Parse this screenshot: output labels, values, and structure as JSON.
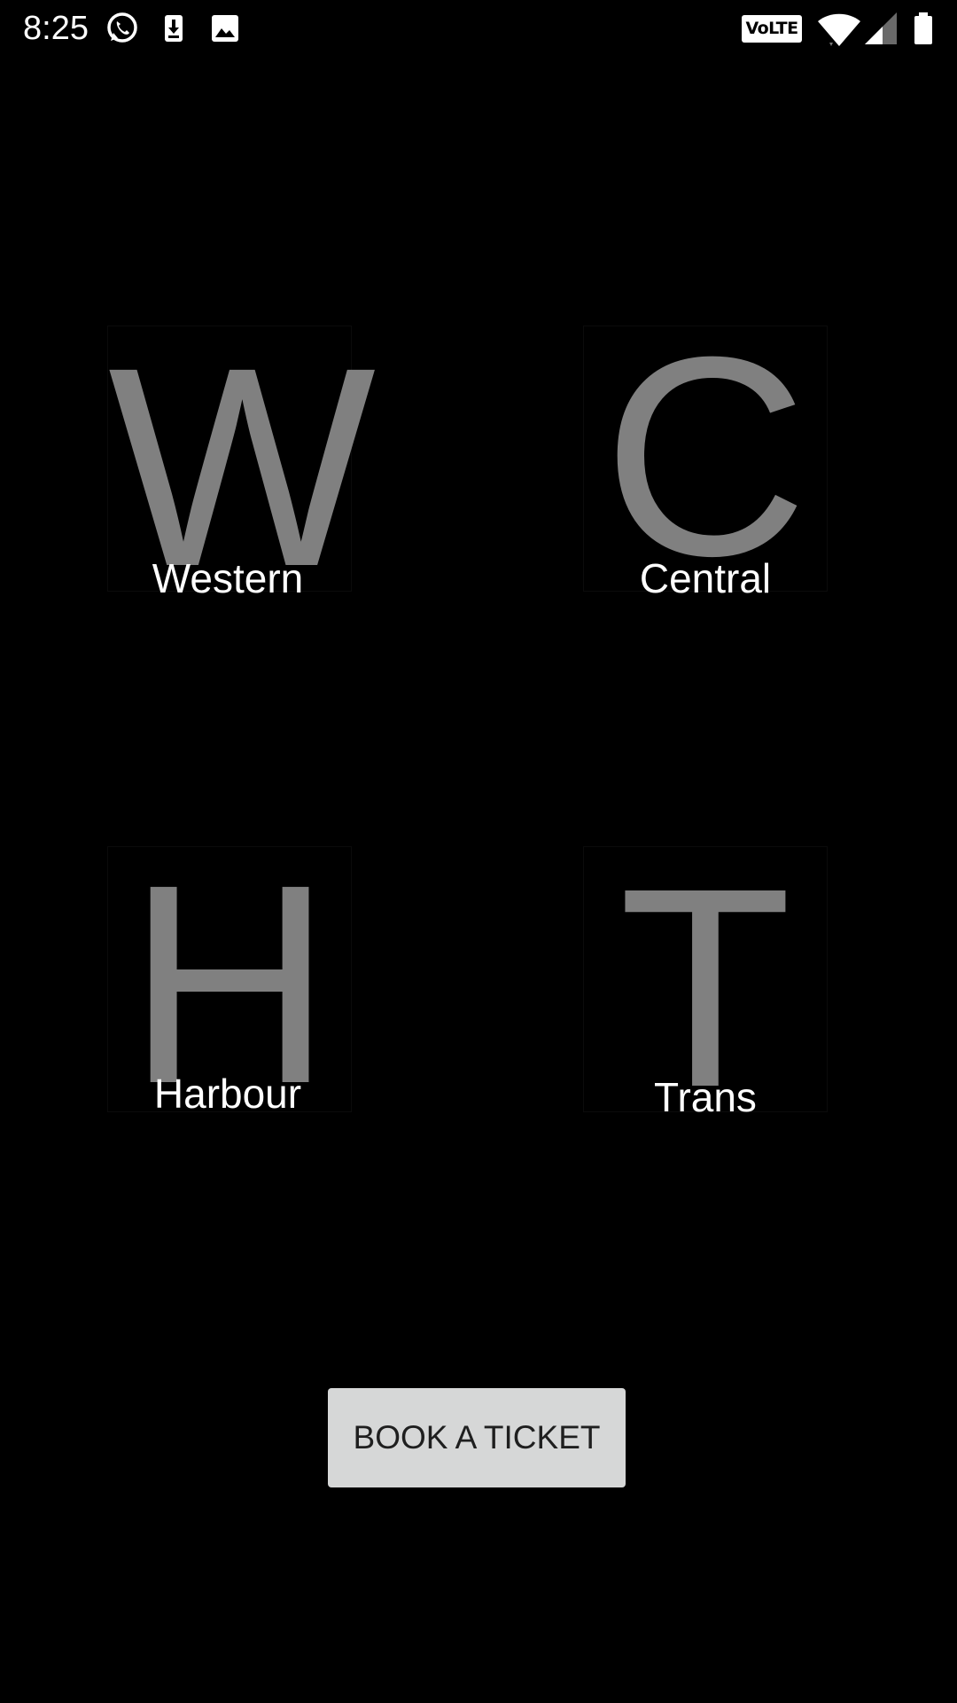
{
  "status_bar": {
    "time": "8:25",
    "notification_icons": [
      "whatsapp-icon",
      "download-icon",
      "image-icon"
    ],
    "network_badge": "VoLTE",
    "system_icons": [
      "wifi-icon",
      "cellular-signal-icon",
      "battery-icon"
    ]
  },
  "lines": [
    {
      "letter": "W",
      "label": "Western"
    },
    {
      "letter": "C",
      "label": "Central"
    },
    {
      "letter": "H",
      "label": "Harbour"
    },
    {
      "letter": "T",
      "label": "Trans"
    }
  ],
  "book_button": {
    "label": "BOOK A TICKET"
  },
  "colors": {
    "background": "#000000",
    "letter": "#808080",
    "label": "#ffffff",
    "button_bg": "#d6d7d7",
    "button_text": "#1f1f1f"
  }
}
